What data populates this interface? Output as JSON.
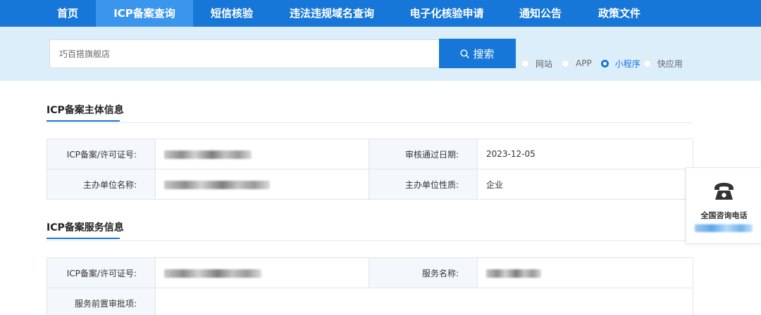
{
  "nav": {
    "items": [
      {
        "label": "首页"
      },
      {
        "label": "ICP备案查询"
      },
      {
        "label": "短信核验"
      },
      {
        "label": "违法违规域名查询"
      },
      {
        "label": "电子化核验申请"
      },
      {
        "label": "通知公告"
      },
      {
        "label": "政策文件"
      }
    ],
    "active": "ICP备案查询"
  },
  "search": {
    "value": "巧百搭旗舰店",
    "button_label": "搜索",
    "button_icon": "search-icon",
    "types": [
      {
        "label": "网站",
        "checked": false
      },
      {
        "label": "APP",
        "checked": false
      },
      {
        "label": "小程序",
        "checked": true
      },
      {
        "label": "快应用",
        "checked": false
      }
    ]
  },
  "subject_info": {
    "title": "ICP备案主体信息",
    "license_label": "ICP备案/许可证号:",
    "review_date_label": "审核通过日期:",
    "review_date_value": "2023-12-05",
    "org_name_label": "主办单位名称:",
    "org_type_label": "主办单位性质:",
    "org_type_value": "企业"
  },
  "service_info": {
    "title": "ICP备案服务信息",
    "license_label": "ICP备案/许可证号:",
    "service_name_label": "服务名称:",
    "pre_approval_label": "服务前置审批项:"
  },
  "hotline": {
    "title": "全国咨询电话",
    "icon": "telephone-icon"
  },
  "colors": {
    "primary": "#1677d8",
    "nav_active": "#3a95ec",
    "search_band": "#ddeefb",
    "label_cell": "#f4f8fd"
  }
}
